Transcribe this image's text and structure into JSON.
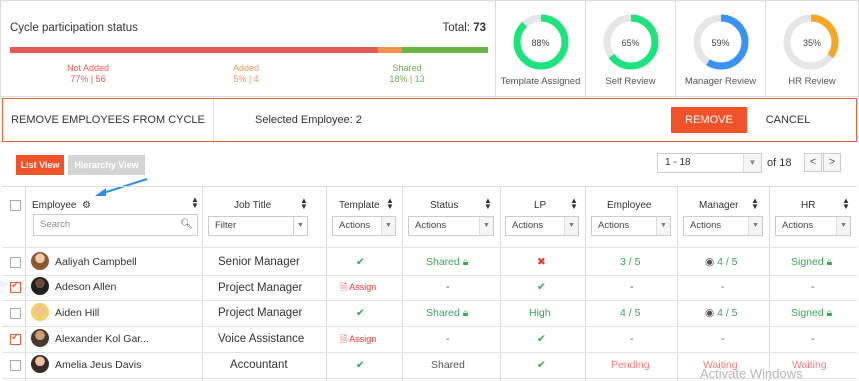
{
  "status": {
    "title": "Cycle participation status",
    "total_label": "Total:",
    "total_value": "73",
    "bar": [
      {
        "label": "Not Added",
        "value": "77% | 56",
        "pct": 77,
        "color": "#e35a5a"
      },
      {
        "label": "Added",
        "value": "5% | 4",
        "pct": 5,
        "color": "#f29450"
      },
      {
        "label": "Shared",
        "value": "18% | 13",
        "pct": 18,
        "color": "#6bb44a"
      }
    ],
    "donuts": [
      {
        "label": "Template Assigned",
        "pct_text": "88%",
        "pct": 88,
        "color": "#1de37c"
      },
      {
        "label": "Self Review",
        "pct_text": "65%",
        "pct": 65,
        "color": "#1de37c"
      },
      {
        "label": "Manager Review",
        "pct_text": "59%",
        "pct": 59,
        "color": "#3a93f0"
      },
      {
        "label": "HR Review",
        "pct_text": "35%",
        "pct": 35,
        "color": "#f5a623"
      }
    ]
  },
  "remove_bar": {
    "title": "REMOVE EMPLOYEES FROM CYCLE",
    "selected": "Selected Employee: 2",
    "remove_label": "REMOVE",
    "cancel_label": "CANCEL"
  },
  "view": {
    "list_label": "List View",
    "hierarchy_label": "Hierarchy View"
  },
  "pager": {
    "range": "1 - 18",
    "of": "of 18",
    "prev": "<",
    "next": ">"
  },
  "table": {
    "headers": {
      "employee": "Employee",
      "job_title": "Job Title",
      "template": "Template",
      "status": "Status",
      "lp": "LP",
      "employee_review": "Employee",
      "manager": "Manager",
      "hr": "HR"
    },
    "search_placeholder": "Search",
    "filter_placeholder": "Filter",
    "actions_label": "Actions",
    "rows": [
      {
        "name": "Aaliyah Campbell",
        "job": "Senior Manager",
        "template": "✔",
        "status": "Shared",
        "lp": "✖",
        "emp": "3 / 5",
        "mgr": "4 / 5",
        "hr": "Signed",
        "checked": false
      },
      {
        "name": "Adeson Allen",
        "job": "Project Manager",
        "template": "Assign",
        "status": "-",
        "lp": "✔",
        "emp": "-",
        "mgr": "-",
        "hr": "-",
        "checked": true
      },
      {
        "name": "Aiden Hill",
        "job": "Project Manager",
        "template": "✔",
        "status": "Shared",
        "lp": "High",
        "emp": "4 / 5",
        "mgr": "4 / 5",
        "hr": "Signed",
        "checked": false
      },
      {
        "name": "Alexander Kol Gar...",
        "job": "Voice Assistance",
        "template": "Assign",
        "status": "-",
        "lp": "✔",
        "emp": "-",
        "mgr": "-",
        "hr": "-",
        "checked": true
      },
      {
        "name": "Amelia Jeus Davis",
        "job": "Accountant",
        "template": "✔",
        "status": "Shared",
        "lp": "✔",
        "emp": "Pending",
        "mgr": "Waiting",
        "hr": "Waiting",
        "checked": false
      }
    ]
  },
  "watermark": "Activate Windows"
}
